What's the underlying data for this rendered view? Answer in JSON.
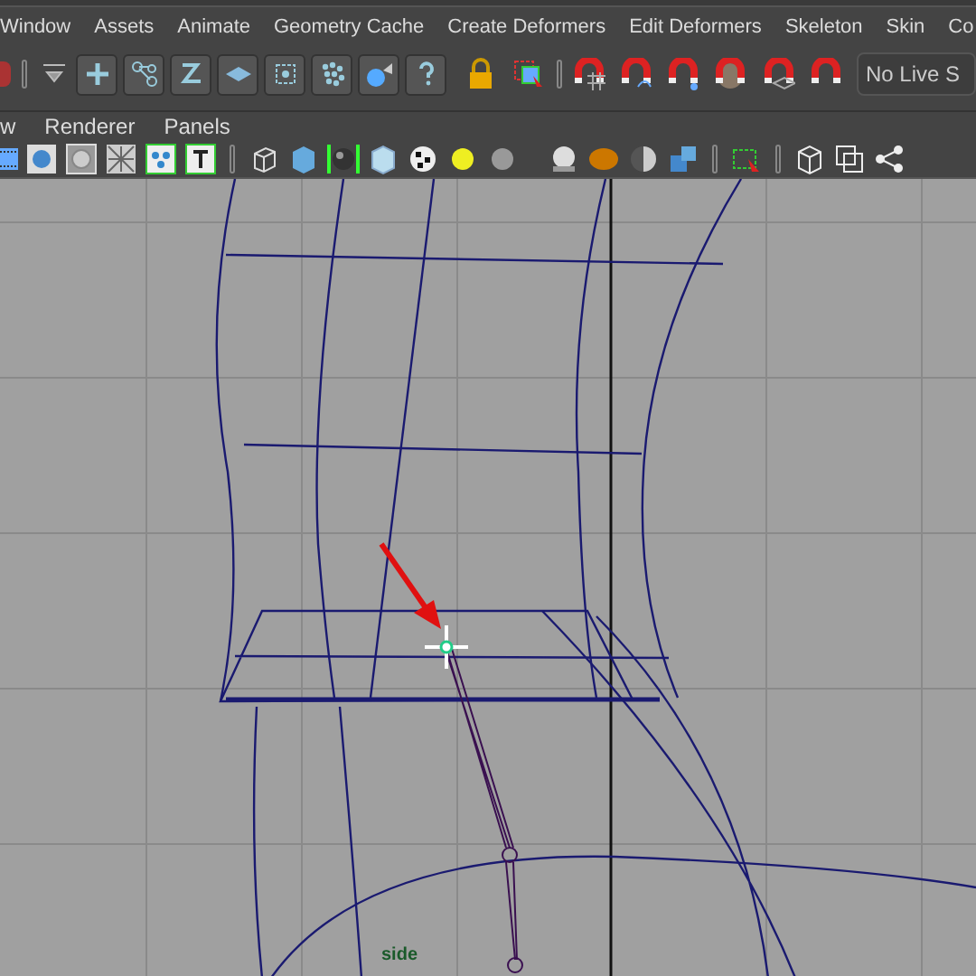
{
  "menu_bar": {
    "items": [
      "Window",
      "Assets",
      "Animate",
      "Geometry Cache",
      "Create Deformers",
      "Edit Deformers",
      "Skeleton",
      "Skin",
      "Co"
    ]
  },
  "status_line": {
    "live_field": "No Live S"
  },
  "panel_menu": {
    "items": [
      "w",
      "Renderer",
      "Panels"
    ]
  },
  "viewport": {
    "camera_label": "side"
  }
}
